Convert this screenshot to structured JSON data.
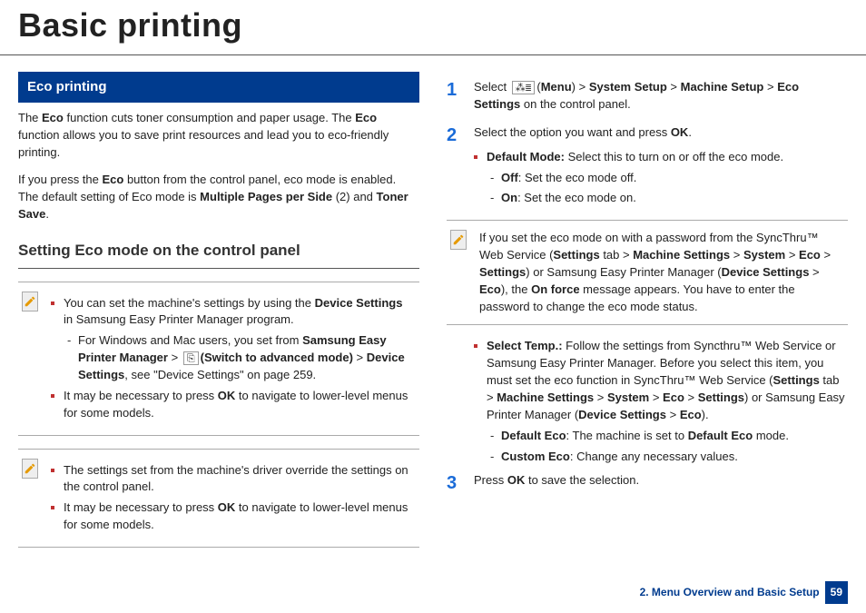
{
  "page_title": "Basic printing",
  "section_header": "Eco printing",
  "intro_para_parts": {
    "p1_a": "The ",
    "p1_b": "Eco",
    "p1_c": " function cuts toner consumption and paper usage. The ",
    "p1_d": "Eco",
    "p1_e": " function allows you to save print resources and lead you to eco-friendly printing."
  },
  "intro_para2": {
    "a": "If you press the ",
    "b": "Eco",
    "c": " button from the control panel, eco mode is enabled. The default setting of Eco mode is ",
    "d": "Multiple Pages per Side",
    "e": " (2) and ",
    "f": "Toner Save",
    "g": "."
  },
  "sub_heading": "Setting Eco mode on the control panel",
  "note1": {
    "b1_a": "You can set the machine's settings by using the ",
    "b1_b": "Device Settings",
    "b1_c": " in Samsung Easy Printer Manager program.",
    "d1_a": "For Windows and Mac users, you set from ",
    "d1_b": "Samsung Easy Printer Manager",
    "d1_c": " > ",
    "d1_icon": "⎘",
    "d1_d": "(Switch to advanced mode)",
    "d1_e": " > ",
    "d1_f": "Device Settings",
    "d1_g": ", see \"Device Settings\" on page 259.",
    "b2_a": "It may be necessary to press ",
    "b2_b": "OK",
    "b2_c": " to navigate to lower-level menus for some models."
  },
  "note2": {
    "b1": "The settings set from the machine's driver override the settings on the control panel.",
    "b2_a": "It may be necessary to press ",
    "b2_b": "OK",
    "b2_c": " to navigate to lower-level menus for some models."
  },
  "step1": {
    "a": "Select ",
    "icon": "⁂≣",
    "b": "(",
    "c": "Menu",
    "d": ") > ",
    "e": "System Setup",
    "f": " > ",
    "g": "Machine Setup",
    "h": " > ",
    "i": "Eco Settings",
    "j": " on the control panel."
  },
  "step2": {
    "a": "Select the option you want and press ",
    "b": "OK",
    "c": ".",
    "default_mode_a": "Default Mode: ",
    "default_mode_b": "Select this to turn on or off the eco mode.",
    "off_a": "Off",
    "off_b": ": Set the eco mode off.",
    "on_a": "On",
    "on_b": ": Set the eco mode on."
  },
  "note3": {
    "a": "If you set the eco mode on with a password from the SyncThru™ Web Service (",
    "b": "Settings",
    "c": " tab > ",
    "d": "Machine Settings",
    "e": " > ",
    "f": "System",
    "g": " > ",
    "h": "Eco",
    "i": " > ",
    "j": "Settings",
    "k": ") or Samsung Easy Printer Manager (",
    "l": "Device Settings",
    "m": " > ",
    "n": "Eco",
    "o": "), the ",
    "p": "On force",
    "q": " message appears. You have to enter the password to change the eco mode status."
  },
  "select_temp": {
    "a": "Select Temp.:",
    "b": " Follow the settings from Syncthru™ Web Service or Samsung Easy Printer Manager. Before you select this item, you must set the eco function in SyncThru™ Web Service (",
    "c": "Settings",
    "d": " tab > ",
    "e": "Machine Settings",
    "f": " > ",
    "g": "System",
    "h": " > ",
    "i": "Eco",
    "j": " > ",
    "k": "Settings",
    "l": ") or Samsung Easy Printer Manager (",
    "m": "Device Settings",
    "n": " > ",
    "o": "Eco",
    "p": ").",
    "de_a": "Default Eco",
    "de_b": ": The machine is set to ",
    "de_c": "Default Eco",
    "de_d": " mode.",
    "ce_a": "Custom Eco",
    "ce_b": ": Change any necessary values."
  },
  "step3": {
    "a": "Press ",
    "b": "OK",
    "c": " to save the selection."
  },
  "footer_label": "2. Menu Overview and Basic Setup",
  "footer_page": "59"
}
